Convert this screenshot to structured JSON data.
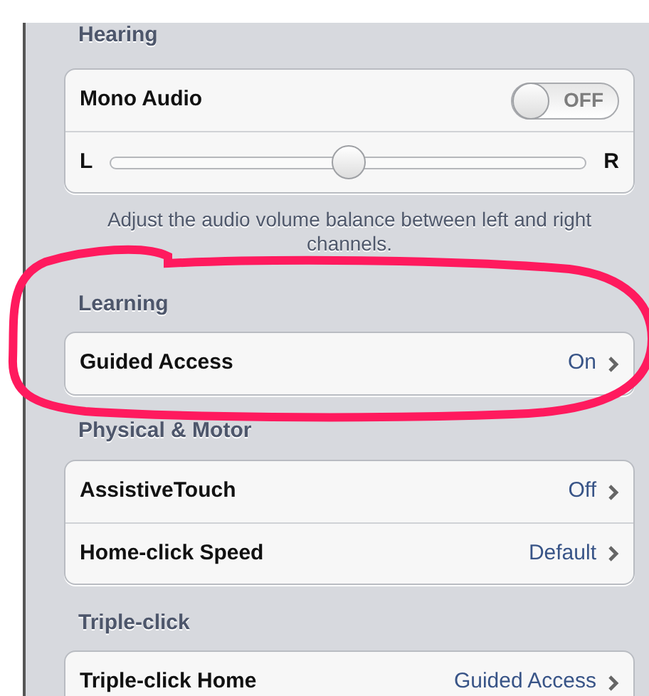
{
  "sections": [
    {
      "header": "Hearing",
      "rows": [
        {
          "kind": "switch",
          "label": "Mono Audio",
          "switch_text": "OFF",
          "on": false
        },
        {
          "kind": "slider",
          "left_label": "L",
          "right_label": "R",
          "level": 0.5
        }
      ],
      "footer": "Adjust the audio volume balance between left and right channels."
    },
    {
      "header": "Learning",
      "rows": [
        {
          "kind": "link",
          "label": "Guided Access",
          "value": "On"
        }
      ]
    },
    {
      "header": "Physical & Motor",
      "rows": [
        {
          "kind": "link",
          "label": "AssistiveTouch",
          "value": "Off"
        },
        {
          "kind": "link",
          "label": "Home-click Speed",
          "value": "Default"
        }
      ]
    },
    {
      "header": "Triple-click",
      "rows": [
        {
          "kind": "link",
          "label": "Triple-click Home",
          "value": "Guided Access"
        }
      ]
    }
  ]
}
